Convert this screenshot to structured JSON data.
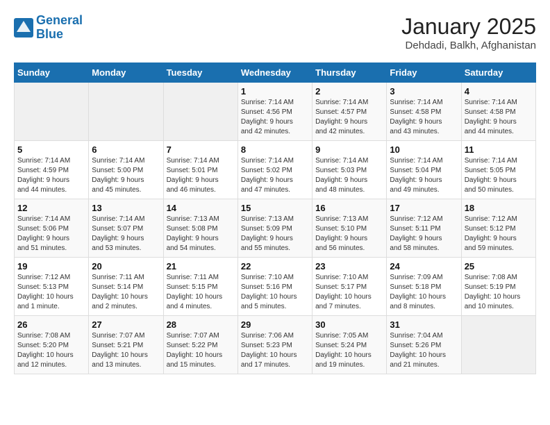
{
  "logo": {
    "line1": "General",
    "line2": "Blue"
  },
  "title": "January 2025",
  "subtitle": "Dehdadi, Balkh, Afghanistan",
  "days_header": [
    "Sunday",
    "Monday",
    "Tuesday",
    "Wednesday",
    "Thursday",
    "Friday",
    "Saturday"
  ],
  "weeks": [
    [
      {
        "day": "",
        "info": ""
      },
      {
        "day": "",
        "info": ""
      },
      {
        "day": "",
        "info": ""
      },
      {
        "day": "1",
        "info": "Sunrise: 7:14 AM\nSunset: 4:56 PM\nDaylight: 9 hours\nand 42 minutes."
      },
      {
        "day": "2",
        "info": "Sunrise: 7:14 AM\nSunset: 4:57 PM\nDaylight: 9 hours\nand 42 minutes."
      },
      {
        "day": "3",
        "info": "Sunrise: 7:14 AM\nSunset: 4:58 PM\nDaylight: 9 hours\nand 43 minutes."
      },
      {
        "day": "4",
        "info": "Sunrise: 7:14 AM\nSunset: 4:58 PM\nDaylight: 9 hours\nand 44 minutes."
      }
    ],
    [
      {
        "day": "5",
        "info": "Sunrise: 7:14 AM\nSunset: 4:59 PM\nDaylight: 9 hours\nand 44 minutes."
      },
      {
        "day": "6",
        "info": "Sunrise: 7:14 AM\nSunset: 5:00 PM\nDaylight: 9 hours\nand 45 minutes."
      },
      {
        "day": "7",
        "info": "Sunrise: 7:14 AM\nSunset: 5:01 PM\nDaylight: 9 hours\nand 46 minutes."
      },
      {
        "day": "8",
        "info": "Sunrise: 7:14 AM\nSunset: 5:02 PM\nDaylight: 9 hours\nand 47 minutes."
      },
      {
        "day": "9",
        "info": "Sunrise: 7:14 AM\nSunset: 5:03 PM\nDaylight: 9 hours\nand 48 minutes."
      },
      {
        "day": "10",
        "info": "Sunrise: 7:14 AM\nSunset: 5:04 PM\nDaylight: 9 hours\nand 49 minutes."
      },
      {
        "day": "11",
        "info": "Sunrise: 7:14 AM\nSunset: 5:05 PM\nDaylight: 9 hours\nand 50 minutes."
      }
    ],
    [
      {
        "day": "12",
        "info": "Sunrise: 7:14 AM\nSunset: 5:06 PM\nDaylight: 9 hours\nand 51 minutes."
      },
      {
        "day": "13",
        "info": "Sunrise: 7:14 AM\nSunset: 5:07 PM\nDaylight: 9 hours\nand 53 minutes."
      },
      {
        "day": "14",
        "info": "Sunrise: 7:13 AM\nSunset: 5:08 PM\nDaylight: 9 hours\nand 54 minutes."
      },
      {
        "day": "15",
        "info": "Sunrise: 7:13 AM\nSunset: 5:09 PM\nDaylight: 9 hours\nand 55 minutes."
      },
      {
        "day": "16",
        "info": "Sunrise: 7:13 AM\nSunset: 5:10 PM\nDaylight: 9 hours\nand 56 minutes."
      },
      {
        "day": "17",
        "info": "Sunrise: 7:12 AM\nSunset: 5:11 PM\nDaylight: 9 hours\nand 58 minutes."
      },
      {
        "day": "18",
        "info": "Sunrise: 7:12 AM\nSunset: 5:12 PM\nDaylight: 9 hours\nand 59 minutes."
      }
    ],
    [
      {
        "day": "19",
        "info": "Sunrise: 7:12 AM\nSunset: 5:13 PM\nDaylight: 10 hours\nand 1 minute."
      },
      {
        "day": "20",
        "info": "Sunrise: 7:11 AM\nSunset: 5:14 PM\nDaylight: 10 hours\nand 2 minutes."
      },
      {
        "day": "21",
        "info": "Sunrise: 7:11 AM\nSunset: 5:15 PM\nDaylight: 10 hours\nand 4 minutes."
      },
      {
        "day": "22",
        "info": "Sunrise: 7:10 AM\nSunset: 5:16 PM\nDaylight: 10 hours\nand 5 minutes."
      },
      {
        "day": "23",
        "info": "Sunrise: 7:10 AM\nSunset: 5:17 PM\nDaylight: 10 hours\nand 7 minutes."
      },
      {
        "day": "24",
        "info": "Sunrise: 7:09 AM\nSunset: 5:18 PM\nDaylight: 10 hours\nand 8 minutes."
      },
      {
        "day": "25",
        "info": "Sunrise: 7:08 AM\nSunset: 5:19 PM\nDaylight: 10 hours\nand 10 minutes."
      }
    ],
    [
      {
        "day": "26",
        "info": "Sunrise: 7:08 AM\nSunset: 5:20 PM\nDaylight: 10 hours\nand 12 minutes."
      },
      {
        "day": "27",
        "info": "Sunrise: 7:07 AM\nSunset: 5:21 PM\nDaylight: 10 hours\nand 13 minutes."
      },
      {
        "day": "28",
        "info": "Sunrise: 7:07 AM\nSunset: 5:22 PM\nDaylight: 10 hours\nand 15 minutes."
      },
      {
        "day": "29",
        "info": "Sunrise: 7:06 AM\nSunset: 5:23 PM\nDaylight: 10 hours\nand 17 minutes."
      },
      {
        "day": "30",
        "info": "Sunrise: 7:05 AM\nSunset: 5:24 PM\nDaylight: 10 hours\nand 19 minutes."
      },
      {
        "day": "31",
        "info": "Sunrise: 7:04 AM\nSunset: 5:26 PM\nDaylight: 10 hours\nand 21 minutes."
      },
      {
        "day": "",
        "info": ""
      }
    ]
  ]
}
